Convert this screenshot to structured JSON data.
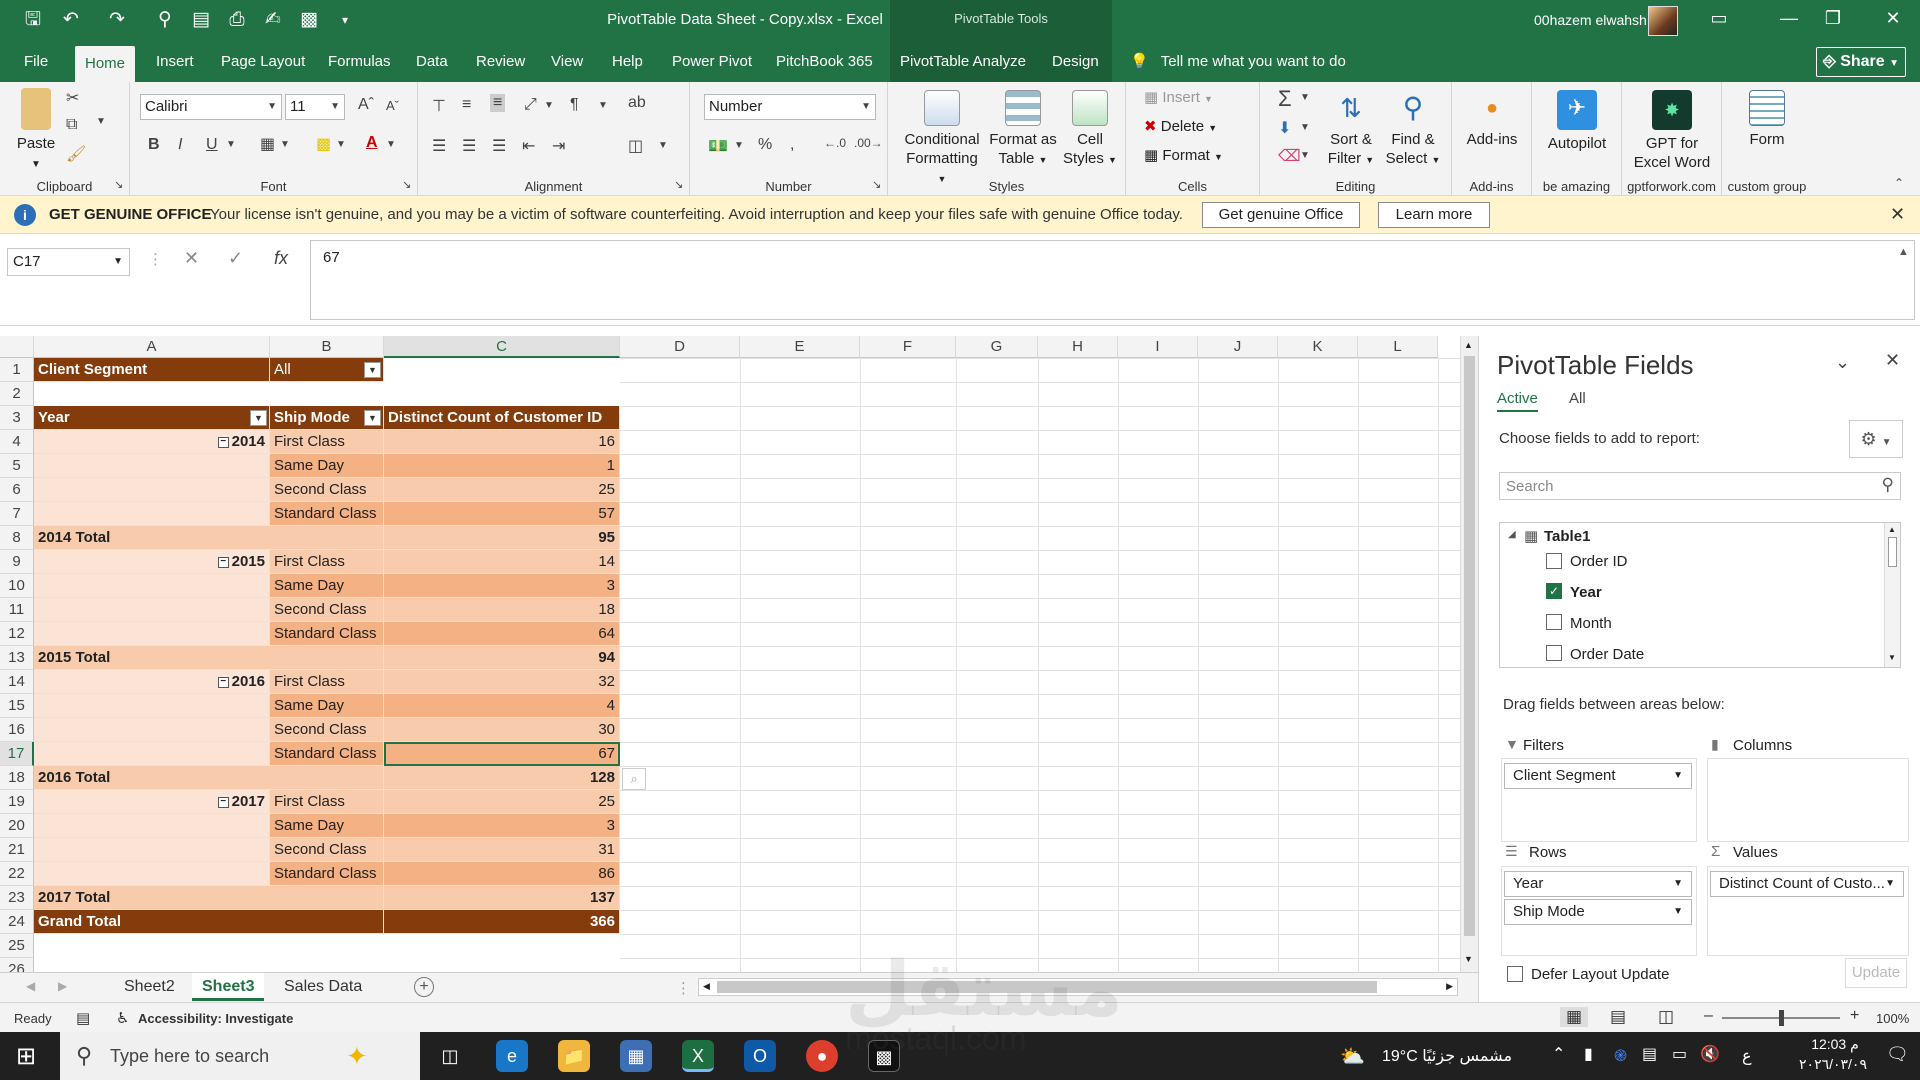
{
  "title": {
    "file": "PivotTable Data Sheet - Copy.xlsx  -  Excel",
    "context": "PivotTable Tools",
    "user": "00hazem elwahsh"
  },
  "tabs": [
    "File",
    "Home",
    "Insert",
    "Page Layout",
    "Formulas",
    "Data",
    "Review",
    "View",
    "Help",
    "Power Pivot",
    "PitchBook 365",
    "PivotTable Analyze",
    "Design"
  ],
  "tell_me": "Tell me what you want to do",
  "share": "Share",
  "ribbon": {
    "paste": "Paste",
    "font_name": "Calibri",
    "font_size": "11",
    "number_format": "Number",
    "cond_fmt": [
      "Conditional",
      "Formatting"
    ],
    "fmt_table": [
      "Format as",
      "Table"
    ],
    "cell_styles": [
      "Cell",
      "Styles"
    ],
    "insert": "Insert",
    "delete": "Delete",
    "format": "Format",
    "sort": [
      "Sort &",
      "Filter"
    ],
    "find": [
      "Find &",
      "Select"
    ],
    "addins": "Add-ins",
    "autopilot": "Autopilot",
    "gpt": [
      "GPT for",
      "Excel Word"
    ],
    "form": "Form",
    "groups": [
      "Clipboard",
      "Font",
      "Alignment",
      "Number",
      "Styles",
      "Cells",
      "Editing",
      "Add-ins",
      "be amazing",
      "gptforwork.com",
      "custom group"
    ]
  },
  "notice": {
    "label": "GET GENUINE OFFICE",
    "message": "Your license isn't genuine, and you may be a victim of software counterfeiting. Avoid interruption and keep your files safe with genuine Office today.",
    "btn1": "Get genuine Office",
    "btn2": "Learn more"
  },
  "formula_bar": {
    "name_box": "C17",
    "content": "67"
  },
  "columns": [
    "A",
    "B",
    "C",
    "D",
    "E",
    "F",
    "G",
    "H",
    "I",
    "J",
    "K",
    "L"
  ],
  "pivot": {
    "filter_label": "Client Segment",
    "filter_value": "All",
    "h_year": "Year",
    "h_ship": "Ship Mode",
    "h_count": "Distinct Count of Customer ID",
    "rows": [
      {
        "year": "2014",
        "ship": "First Class",
        "val": "16"
      },
      {
        "year": "",
        "ship": "Same Day",
        "val": "1"
      },
      {
        "year": "",
        "ship": "Second Class",
        "val": "25"
      },
      {
        "year": "",
        "ship": "Standard Class",
        "val": "57"
      },
      {
        "total": "2014 Total",
        "val": "95"
      },
      {
        "year": "2015",
        "ship": "First Class",
        "val": "14"
      },
      {
        "year": "",
        "ship": "Same Day",
        "val": "3"
      },
      {
        "year": "",
        "ship": "Second Class",
        "val": "18"
      },
      {
        "year": "",
        "ship": "Standard Class",
        "val": "64"
      },
      {
        "total": "2015 Total",
        "val": "94"
      },
      {
        "year": "2016",
        "ship": "First Class",
        "val": "32"
      },
      {
        "year": "",
        "ship": "Same Day",
        "val": "4"
      },
      {
        "year": "",
        "ship": "Second Class",
        "val": "30"
      },
      {
        "year": "",
        "ship": "Standard Class",
        "val": "67"
      },
      {
        "total": "2016 Total",
        "val": "128"
      },
      {
        "year": "2017",
        "ship": "First Class",
        "val": "25"
      },
      {
        "year": "",
        "ship": "Same Day",
        "val": "3"
      },
      {
        "year": "",
        "ship": "Second Class",
        "val": "31"
      },
      {
        "year": "",
        "ship": "Standard Class",
        "val": "86"
      },
      {
        "total": "2017 Total",
        "val": "137"
      }
    ],
    "grand_total_label": "Grand Total",
    "grand_total": "366"
  },
  "sheets": [
    "Sheet2",
    "Sheet3",
    "Sales Data"
  ],
  "pane": {
    "title": "PivotTable Fields",
    "tab_active": "Active",
    "tab_all": "All",
    "choose": "Choose fields to add to report:",
    "search_placeholder": "Search",
    "table": "Table1",
    "fields": [
      {
        "name": "Order ID",
        "checked": false
      },
      {
        "name": "Year",
        "checked": true
      },
      {
        "name": "Month",
        "checked": false
      },
      {
        "name": "Order Date",
        "checked": false
      }
    ],
    "drag": "Drag fields between areas below:",
    "filters": "Filters",
    "columns": "Columns",
    "rows": "Rows",
    "values": "Values",
    "filter_field": "Client Segment",
    "row_field1": "Year",
    "row_field2": "Ship Mode",
    "value_field": "Distinct Count of Custo...",
    "defer": "Defer Layout Update",
    "update": "Update"
  },
  "status": {
    "ready": "Ready",
    "accessibility": "Accessibility: Investigate",
    "zoom": "100%"
  },
  "taskbar": {
    "search": "Type here to search",
    "weather": "19°C  مشمس جزئيًا",
    "time": "12:03 م",
    "date": "٢٠٢٦/٠٣/٠٩",
    "lang": "ع"
  },
  "watermark": {
    "ar": "مستقل",
    "url": "mostaql.com"
  }
}
